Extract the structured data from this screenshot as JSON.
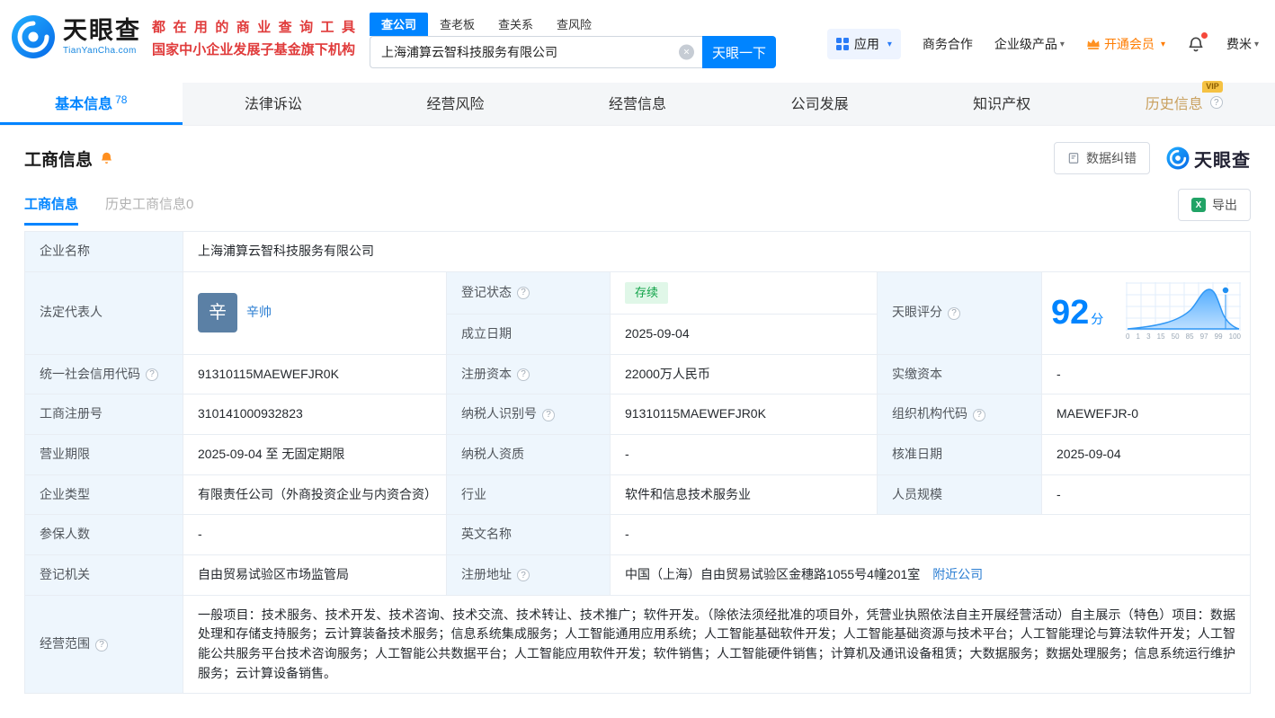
{
  "colors": {
    "brand_blue": "#0084ff",
    "vip_orange": "#ff7c00",
    "history_gold": "#c9a05e",
    "status_green": "#10a348",
    "promo_red": "#e03b3b",
    "label_cell_bg": "#eef6fd"
  },
  "icons": {
    "caret_down": "▾",
    "clear": "×",
    "help": "?",
    "excel_x": "X"
  },
  "header": {
    "logo": {
      "brand": "天眼查",
      "domain": "TianYanCha.com"
    },
    "promo": {
      "line1": "都在用的商业查询工具",
      "line2": "国家中小企业发展子基金旗下机构"
    },
    "search": {
      "tabs": [
        {
          "label": "查公司",
          "active": true
        },
        {
          "label": "查老板",
          "active": false
        },
        {
          "label": "查关系",
          "active": false
        },
        {
          "label": "查风险",
          "active": false
        }
      ],
      "value": "上海浦算云智科技服务有限公司",
      "button": "天眼一下"
    },
    "nav": {
      "apps": "应用",
      "cooperation": "商务合作",
      "enterprise": "企业级产品",
      "vip": "开通会员",
      "user": "费米"
    }
  },
  "tabs": [
    {
      "label": "基本信息",
      "count": "78",
      "active": true
    },
    {
      "label": "法律诉讼",
      "active": false
    },
    {
      "label": "经营风险",
      "active": false
    },
    {
      "label": "经营信息",
      "active": false
    },
    {
      "label": "公司发展",
      "active": false
    },
    {
      "label": "知识产权",
      "active": false
    },
    {
      "label": "历史信息",
      "badge": "VIP",
      "active": false
    }
  ],
  "section": {
    "title": "工商信息",
    "data_correction": "数据纠错",
    "watermark": "天眼查",
    "subtabs": [
      {
        "label": "工商信息",
        "active": true
      },
      {
        "label": "历史工商信息",
        "count": "0",
        "active": false
      }
    ],
    "export": "导出"
  },
  "table": {
    "company_name": {
      "label": "企业名称",
      "value": "上海浦算云智科技服务有限公司"
    },
    "legal_rep": {
      "label": "法定代表人",
      "avatar_char": "辛",
      "value": "辛帅"
    },
    "reg_status": {
      "label": "登记状态",
      "value": "存续"
    },
    "establish_date": {
      "label": "成立日期",
      "value": "2025-09-04"
    },
    "tyc_score": {
      "label": "天眼评分",
      "value": "92",
      "unit": "分"
    },
    "credit_code": {
      "label": "统一社会信用代码",
      "value": "91310115MAEWEFJR0K"
    },
    "reg_capital": {
      "label": "注册资本",
      "value": "22000万人民币"
    },
    "paid_capital": {
      "label": "实缴资本",
      "value": "-"
    },
    "reg_number": {
      "label": "工商注册号",
      "value": "310141000932823"
    },
    "taxpayer_id": {
      "label": "纳税人识别号",
      "value": "91310115MAEWEFJR0K"
    },
    "org_code": {
      "label": "组织机构代码",
      "value": "MAEWEFJR-0"
    },
    "business_term": {
      "label": "营业期限",
      "value": "2025-09-04 至 无固定期限"
    },
    "taxpayer_qualification": {
      "label": "纳税人资质",
      "value": "-"
    },
    "approval_date": {
      "label": "核准日期",
      "value": "2025-09-04"
    },
    "company_type": {
      "label": "企业类型",
      "value": "有限责任公司（外商投资企业与内资合资）"
    },
    "industry": {
      "label": "行业",
      "value": "软件和信息技术服务业"
    },
    "staff_size": {
      "label": "人员规模",
      "value": "-"
    },
    "insured_count": {
      "label": "参保人数",
      "value": "-"
    },
    "english_name": {
      "label": "英文名称",
      "value": "-"
    },
    "reg_authority": {
      "label": "登记机关",
      "value": "自由贸易试验区市场监管局"
    },
    "reg_address": {
      "label": "注册地址",
      "value": "中国（上海）自由贸易试验区金穗路1055号4幢201室",
      "link": "附近公司"
    },
    "business_scope": {
      "label": "经营范围",
      "value": "一般项目：技术服务、技术开发、技术咨询、技术交流、技术转让、技术推广；软件开发。（除依法须经批准的项目外，凭营业执照依法自主开展经营活动）自主展示（特色）项目：数据处理和存储支持服务；云计算装备技术服务；信息系统集成服务；人工智能通用应用系统；人工智能基础软件开发；人工智能基础资源与技术平台；人工智能理论与算法软件开发；人工智能公共服务平台技术咨询服务；人工智能公共数据平台；人工智能应用软件开发；软件销售；人工智能硬件销售；计算机及通讯设备租赁；大数据服务；数据处理服务；信息系统运行维护服务；云计算设备销售。"
    }
  },
  "score_chart": {
    "xticks": [
      "0",
      "1",
      "3",
      "15",
      "50",
      "85",
      "97",
      "99",
      "100"
    ]
  }
}
